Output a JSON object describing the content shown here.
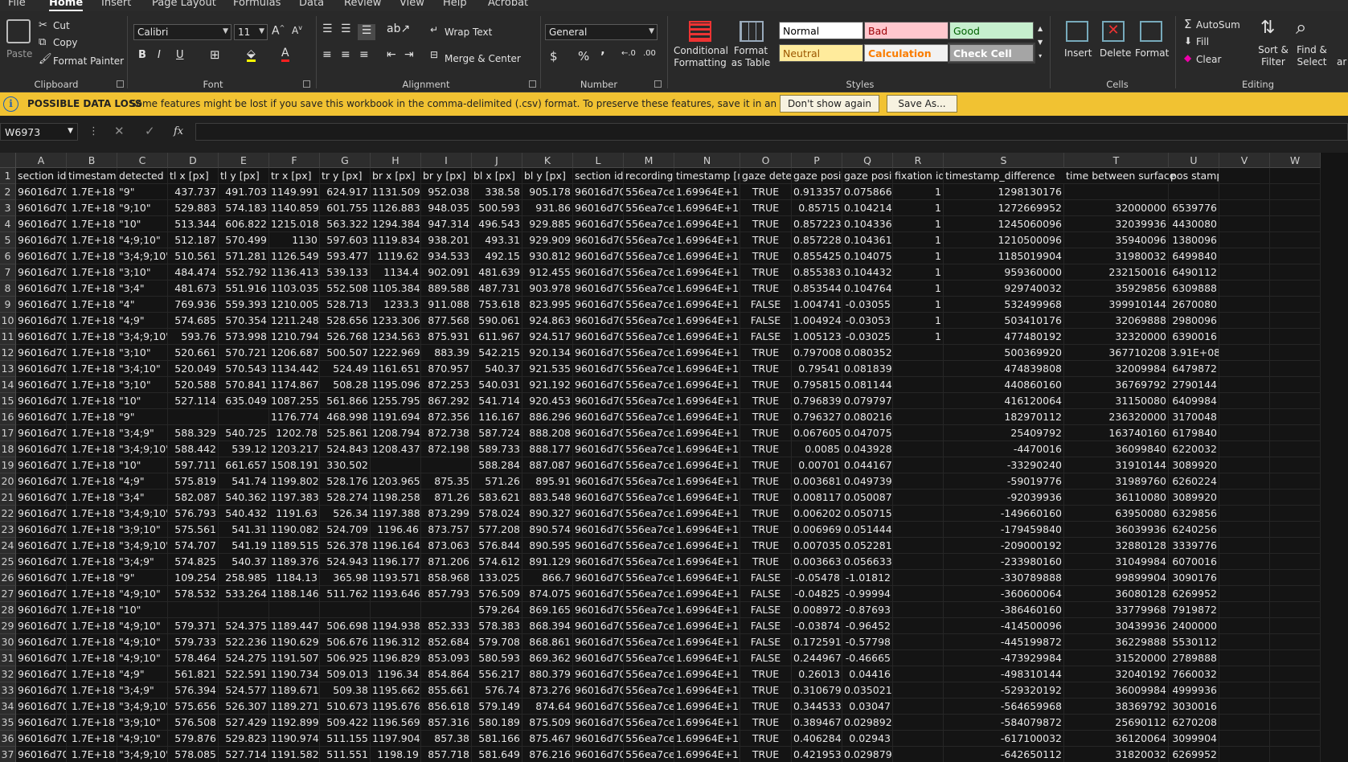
{
  "ribbon_tabs": [
    "File",
    "Home",
    "Insert",
    "Page Layout",
    "Formulas",
    "Data",
    "Review",
    "View",
    "Help",
    "Acrobat"
  ],
  "active_tab": "Home",
  "clipboard": {
    "paste": "Paste",
    "cut": "Cut",
    "copy": "Copy",
    "format_painter": "Format Painter",
    "group": "Clipboard"
  },
  "font": {
    "name": "Calibri",
    "size": "11",
    "bold": "B",
    "italic": "I",
    "underline": "U",
    "group": "Font"
  },
  "alignment": {
    "wrap_text": "Wrap Text",
    "merge_center": "Merge & Center",
    "group": "Alignment"
  },
  "number": {
    "format": "General",
    "currency": "$",
    "percent": "%",
    "comma": "’",
    "group": "Number"
  },
  "styles": {
    "conditional_formatting": "Conditional Formatting",
    "format_as_table": "Format as Table",
    "normal": "Normal",
    "bad": "Bad",
    "good": "Good",
    "neutral": "Neutral",
    "calculation": "Calculation",
    "check_cell": "Check Cell",
    "group": "Styles",
    "colors": {
      "normal_bg": "#ffffff",
      "bad_bg": "#ffc7ce",
      "bad_fg": "#9c0006",
      "good_bg": "#c6efce",
      "good_fg": "#006100",
      "neutral_bg": "#ffeb9c",
      "neutral_fg": "#9c5700",
      "calc_bg": "#f2f2f2",
      "calc_fg": "#fa7d00",
      "check_bg": "#a5a5a5"
    }
  },
  "cells_group": {
    "insert": "Insert",
    "delete": "Delete",
    "format": "Format",
    "group": "Cells"
  },
  "editing": {
    "autosum": "AutoSum",
    "fill": "Fill",
    "clear": "Clear",
    "sort_filter": "Sort & Filter",
    "find_select": "Find & Select",
    "group": "Editing",
    "extra": "ar"
  },
  "infobar": {
    "title": "POSSIBLE DATA LOSS",
    "message": "Some features might be lost if you save this workbook in the comma-delimited (.csv) format. To preserve these features, save it in an Excel file format.",
    "dont_show": "Don't show again",
    "save_as": "Save As..."
  },
  "namebox": "W6973",
  "fx_label": "fx",
  "columns": [
    "A",
    "B",
    "C",
    "D",
    "E",
    "F",
    "G",
    "H",
    "I",
    "J",
    "K",
    "L",
    "M",
    "N",
    "O",
    "P",
    "Q",
    "R",
    "S",
    "T",
    "U",
    "V",
    "W"
  ],
  "row1": [
    "section id",
    "timestamp",
    "detected m",
    "tl x [px]",
    "tl y [px]",
    "tr x [px]",
    "tr y [px]",
    "br x [px]",
    "br y [px]",
    "bl x [px]",
    "bl y [px]",
    "section id",
    "recording",
    "timestamp [ns]",
    "gaze dete",
    "gaze posit",
    "gaze posit",
    "fixation id",
    "timestamp_difference",
    "time between surface",
    "pos stamps",
    "",
    ""
  ],
  "rows": [
    [
      "96016d70-",
      "1.7E+18",
      "\"9\"",
      "437.737",
      "491.703",
      "1149.991",
      "624.917",
      "1131.509",
      "952.038",
      "338.58",
      "905.178",
      "96016d70-",
      "556ea7ce-",
      "1.69964E+18",
      "TRUE",
      "0.913357",
      "0.075866",
      "1",
      "1298130176",
      "",
      "",
      "",
      ""
    ],
    [
      "96016d70-",
      "1.7E+18",
      "\"9;10\"",
      "529.883",
      "574.183",
      "1140.859",
      "601.755",
      "1126.883",
      "948.035",
      "500.593",
      "931.86",
      "96016d70-",
      "556ea7ce-",
      "1.69964E+18",
      "TRUE",
      "0.85715",
      "0.104214",
      "1",
      "1272669952",
      "32000000",
      "6539776",
      "",
      ""
    ],
    [
      "96016d70-",
      "1.7E+18",
      "\"10\"",
      "513.344",
      "606.822",
      "1215.018",
      "563.322",
      "1294.384",
      "947.314",
      "496.543",
      "929.885",
      "96016d70-",
      "556ea7ce-",
      "1.69964E+18",
      "TRUE",
      "0.857223",
      "0.104336",
      "1",
      "1245060096",
      "32039936",
      "4430080",
      "",
      ""
    ],
    [
      "96016d70-",
      "1.7E+18",
      "\"4;9;10\"",
      "512.187",
      "570.499",
      "1130",
      "597.603",
      "1119.834",
      "938.201",
      "493.31",
      "929.909",
      "96016d70-",
      "556ea7ce-",
      "1.69964E+18",
      "TRUE",
      "0.857228",
      "0.104361",
      "1",
      "1210500096",
      "35940096",
      "1380096",
      "",
      ""
    ],
    [
      "96016d70-",
      "1.7E+18",
      "\"3;4;9;10\"",
      "510.561",
      "571.281",
      "1126.549",
      "593.477",
      "1119.62",
      "934.533",
      "492.15",
      "930.812",
      "96016d70-",
      "556ea7ce-",
      "1.69964E+18",
      "TRUE",
      "0.855425",
      "0.104075",
      "1",
      "1185019904",
      "31980032",
      "6499840",
      "",
      ""
    ],
    [
      "96016d70-",
      "1.7E+18",
      "\"3;10\"",
      "484.474",
      "552.792",
      "1136.413",
      "539.133",
      "1134.4",
      "902.091",
      "481.639",
      "912.455",
      "96016d70-",
      "556ea7ce-",
      "1.69964E+18",
      "TRUE",
      "0.855383",
      "0.104432",
      "1",
      "959360000",
      "232150016",
      "6490112",
      "",
      ""
    ],
    [
      "96016d70-",
      "1.7E+18",
      "\"3;4\"",
      "481.673",
      "551.916",
      "1103.035",
      "552.508",
      "1105.384",
      "889.588",
      "487.731",
      "903.978",
      "96016d70-",
      "556ea7ce-",
      "1.69964E+18",
      "TRUE",
      "0.853544",
      "0.104764",
      "1",
      "929740032",
      "35929856",
      "6309888",
      "",
      ""
    ],
    [
      "96016d70-",
      "1.7E+18",
      "\"4\"",
      "769.936",
      "559.393",
      "1210.005",
      "528.713",
      "1233.3",
      "911.088",
      "753.618",
      "823.995",
      "96016d70-",
      "556ea7ce-",
      "1.69964E+18",
      "FALSE",
      "1.004741",
      "-0.03055",
      "1",
      "532499968",
      "399910144",
      "2670080",
      "",
      ""
    ],
    [
      "96016d70-",
      "1.7E+18",
      "\"4;9\"",
      "574.685",
      "570.354",
      "1211.248",
      "528.656",
      "1233.306",
      "877.568",
      "590.061",
      "924.863",
      "96016d70-",
      "556ea7ce-",
      "1.69964E+18",
      "FALSE",
      "1.004924",
      "-0.03053",
      "1",
      "503410176",
      "32069888",
      "2980096",
      "",
      ""
    ],
    [
      "96016d70-",
      "1.7E+18",
      "\"3;4;9;10\"",
      "593.76",
      "573.998",
      "1210.794",
      "526.768",
      "1234.563",
      "875.931",
      "611.967",
      "924.517",
      "96016d70-",
      "556ea7ce-",
      "1.69964E+18",
      "FALSE",
      "1.005123",
      "-0.03025",
      "1",
      "477480192",
      "32320000",
      "6390016",
      "",
      ""
    ],
    [
      "96016d70-",
      "1.7E+18",
      "\"3;10\"",
      "520.661",
      "570.721",
      "1206.687",
      "500.507",
      "1222.969",
      "883.39",
      "542.215",
      "920.134",
      "96016d70-",
      "556ea7ce-",
      "1.69964E+18",
      "TRUE",
      "0.797008",
      "0.080352",
      "",
      "500369920",
      "367710208",
      "3.91E+08",
      "",
      ""
    ],
    [
      "96016d70-",
      "1.7E+18",
      "\"3;4;10\"",
      "520.049",
      "570.543",
      "1134.442",
      "524.49",
      "1161.651",
      "870.957",
      "540.37",
      "921.535",
      "96016d70-",
      "556ea7ce-",
      "1.69964E+18",
      "TRUE",
      "0.79541",
      "0.081839",
      "",
      "474839808",
      "32009984",
      "6479872",
      "",
      ""
    ],
    [
      "96016d70-",
      "1.7E+18",
      "\"3;10\"",
      "520.588",
      "570.841",
      "1174.867",
      "508.28",
      "1195.096",
      "872.253",
      "540.031",
      "921.192",
      "96016d70-",
      "556ea7ce-",
      "1.69964E+18",
      "TRUE",
      "0.795815",
      "0.081144",
      "",
      "440860160",
      "36769792",
      "2790144",
      "",
      ""
    ],
    [
      "96016d70-",
      "1.7E+18",
      "\"10\"",
      "527.114",
      "635.049",
      "1087.255",
      "561.866",
      "1255.795",
      "867.292",
      "541.714",
      "920.453",
      "96016d70-",
      "556ea7ce-",
      "1.69964E+18",
      "TRUE",
      "0.796839",
      "0.079797",
      "",
      "416120064",
      "31150080",
      "6409984",
      "",
      ""
    ],
    [
      "96016d70-",
      "1.7E+18",
      "\"9\"",
      "",
      "",
      "1176.774",
      "468.998",
      "1191.694",
      "872.356",
      "116.167",
      "886.296",
      "96016d70-",
      "556ea7ce-",
      "1.69964E+18",
      "TRUE",
      "0.796327",
      "0.080216",
      "",
      "182970112",
      "236320000",
      "3170048",
      "",
      ""
    ],
    [
      "96016d70-",
      "1.7E+18",
      "\"3;4;9\"",
      "588.329",
      "540.725",
      "1202.78",
      "525.861",
      "1208.794",
      "872.738",
      "587.724",
      "888.208",
      "96016d70-",
      "556ea7ce-",
      "1.69964E+18",
      "TRUE",
      "0.067605",
      "0.047075",
      "",
      "25409792",
      "163740160",
      "6179840",
      "",
      ""
    ],
    [
      "96016d70-",
      "1.7E+18",
      "\"3;4;9;10\"",
      "588.442",
      "539.12",
      "1203.217",
      "524.843",
      "1208.437",
      "872.198",
      "589.733",
      "888.177",
      "96016d70-",
      "556ea7ce-",
      "1.69964E+18",
      "TRUE",
      "0.0085",
      "0.043928",
      "",
      "-4470016",
      "36099840",
      "6220032",
      "",
      ""
    ],
    [
      "96016d70-",
      "1.7E+18",
      "\"10\"",
      "597.711",
      "661.657",
      "1508.191",
      "330.502",
      "",
      "",
      "588.284",
      "887.087",
      "96016d70-",
      "556ea7ce-",
      "1.69964E+18",
      "TRUE",
      "0.00701",
      "0.044167",
      "",
      "-33290240",
      "31910144",
      "3089920",
      "",
      ""
    ],
    [
      "96016d70-",
      "1.7E+18",
      "\"4;9\"",
      "575.819",
      "541.74",
      "1199.802",
      "528.176",
      "1203.965",
      "875.35",
      "571.26",
      "895.91",
      "96016d70-",
      "556ea7ce-",
      "1.69964E+18",
      "TRUE",
      "0.003681",
      "0.049739",
      "",
      "-59019776",
      "31989760",
      "6260224",
      "",
      ""
    ],
    [
      "96016d70-",
      "1.7E+18",
      "\"3;4\"",
      "582.087",
      "540.362",
      "1197.383",
      "528.274",
      "1198.258",
      "871.26",
      "583.621",
      "883.548",
      "96016d70-",
      "556ea7ce-",
      "1.69964E+18",
      "TRUE",
      "0.008117",
      "0.050087",
      "",
      "-92039936",
      "36110080",
      "3089920",
      "",
      ""
    ],
    [
      "96016d70-",
      "1.7E+18",
      "\"3;4;9;10\"",
      "576.793",
      "540.432",
      "1191.63",
      "526.34",
      "1197.388",
      "873.299",
      "578.024",
      "890.327",
      "96016d70-",
      "556ea7ce-",
      "1.69964E+18",
      "TRUE",
      "0.006202",
      "0.050715",
      "",
      "-149660160",
      "63950080",
      "6329856",
      "",
      ""
    ],
    [
      "96016d70-",
      "1.7E+18",
      "\"3;9;10\"",
      "575.561",
      "541.31",
      "1190.082",
      "524.709",
      "1196.46",
      "873.757",
      "577.208",
      "890.574",
      "96016d70-",
      "556ea7ce-",
      "1.69964E+18",
      "TRUE",
      "0.006969",
      "0.051444",
      "",
      "-179459840",
      "36039936",
      "6240256",
      "",
      ""
    ],
    [
      "96016d70-",
      "1.7E+18",
      "\"3;4;9;10\"",
      "574.707",
      "541.19",
      "1189.515",
      "526.378",
      "1196.164",
      "873.063",
      "576.844",
      "890.595",
      "96016d70-",
      "556ea7ce-",
      "1.69964E+18",
      "TRUE",
      "0.007035",
      "0.052281",
      "",
      "-209000192",
      "32880128",
      "3339776",
      "",
      ""
    ],
    [
      "96016d70-",
      "1.7E+18",
      "\"3;4;9\"",
      "574.825",
      "540.37",
      "1189.376",
      "524.943",
      "1196.177",
      "871.206",
      "574.612",
      "891.129",
      "96016d70-",
      "556ea7ce-",
      "1.69964E+18",
      "TRUE",
      "0.003663",
      "0.056633",
      "",
      "-233980160",
      "31049984",
      "6070016",
      "",
      ""
    ],
    [
      "96016d70-",
      "1.7E+18",
      "\"9\"",
      "109.254",
      "258.985",
      "1184.13",
      "365.98",
      "1193.571",
      "858.968",
      "133.025",
      "866.7",
      "96016d70-",
      "556ea7ce-",
      "1.69964E+18",
      "FALSE",
      "-0.05478",
      "-1.01812",
      "",
      "-330789888",
      "99899904",
      "3090176",
      "",
      ""
    ],
    [
      "96016d70-",
      "1.7E+18",
      "\"4;9;10\"",
      "578.532",
      "533.264",
      "1188.146",
      "511.762",
      "1193.646",
      "857.793",
      "576.509",
      "874.075",
      "96016d70-",
      "556ea7ce-",
      "1.69964E+18",
      "FALSE",
      "-0.04825",
      "-0.99994",
      "",
      "-360600064",
      "36080128",
      "6269952",
      "",
      ""
    ],
    [
      "96016d70-",
      "1.7E+18",
      "\"10\"",
      "",
      "",
      "",
      "",
      "",
      "",
      "579.264",
      "869.165",
      "96016d70-",
      "556ea7ce-",
      "1.69964E+18",
      "FALSE",
      "0.008972",
      "-0.87693",
      "",
      "-386460160",
      "33779968",
      "7919872",
      "",
      ""
    ],
    [
      "96016d70-",
      "1.7E+18",
      "\"4;9;10\"",
      "579.371",
      "524.375",
      "1189.447",
      "506.698",
      "1194.938",
      "852.333",
      "578.383",
      "868.394",
      "96016d70-",
      "556ea7ce-",
      "1.69964E+18",
      "FALSE",
      "-0.03874",
      "-0.96452",
      "",
      "-414500096",
      "30439936",
      "2400000",
      "",
      ""
    ],
    [
      "96016d70-",
      "1.7E+18",
      "\"4;9;10\"",
      "579.733",
      "522.236",
      "1190.629",
      "506.676",
      "1196.312",
      "852.684",
      "579.708",
      "868.861",
      "96016d70-",
      "556ea7ce-",
      "1.69964E+18",
      "FALSE",
      "0.172591",
      "-0.57798",
      "",
      "-445199872",
      "36229888",
      "5530112",
      "",
      ""
    ],
    [
      "96016d70-",
      "1.7E+18",
      "\"4;9;10\"",
      "578.464",
      "524.275",
      "1191.507",
      "506.925",
      "1196.829",
      "853.093",
      "580.593",
      "869.362",
      "96016d70-",
      "556ea7ce-",
      "1.69964E+18",
      "FALSE",
      "0.244967",
      "-0.46665",
      "",
      "-473929984",
      "31520000",
      "2789888",
      "",
      ""
    ],
    [
      "96016d70-",
      "1.7E+18",
      "\"4;9\"",
      "561.821",
      "522.591",
      "1190.734",
      "509.013",
      "1196.34",
      "854.864",
      "556.217",
      "880.379",
      "96016d70-",
      "556ea7ce-",
      "1.69964E+18",
      "TRUE",
      "0.26013",
      "0.04416",
      "",
      "-498310144",
      "32040192",
      "7660032",
      "",
      ""
    ],
    [
      "96016d70-",
      "1.7E+18",
      "\"3;4;9\"",
      "576.394",
      "524.577",
      "1189.671",
      "509.38",
      "1195.662",
      "855.661",
      "576.74",
      "873.276",
      "96016d70-",
      "556ea7ce-",
      "1.69964E+18",
      "TRUE",
      "0.310679",
      "0.035021",
      "",
      "-529320192",
      "36009984",
      "4999936",
      "",
      ""
    ],
    [
      "96016d70-",
      "1.7E+18",
      "\"3;4;9;10\"",
      "575.656",
      "526.307",
      "1189.271",
      "510.673",
      "1195.676",
      "856.618",
      "579.149",
      "874.64",
      "96016d70-",
      "556ea7ce-",
      "1.69964E+18",
      "TRUE",
      "0.344533",
      "0.03047",
      "",
      "-564659968",
      "38369792",
      "3030016",
      "",
      ""
    ],
    [
      "96016d70-",
      "1.7E+18",
      "\"3;9;10\"",
      "576.508",
      "527.429",
      "1192.899",
      "509.422",
      "1196.569",
      "857.316",
      "580.189",
      "875.509",
      "96016d70-",
      "556ea7ce-",
      "1.69964E+18",
      "TRUE",
      "0.389467",
      "0.029892",
      "",
      "-584079872",
      "25690112",
      "6270208",
      "",
      ""
    ],
    [
      "96016d70-",
      "1.7E+18",
      "\"4;9;10\"",
      "579.876",
      "529.823",
      "1190.974",
      "511.155",
      "1197.904",
      "857.38",
      "581.166",
      "875.467",
      "96016d70-",
      "556ea7ce-",
      "1.69964E+18",
      "TRUE",
      "0.406284",
      "0.02943",
      "",
      "-617100032",
      "36120064",
      "3099904",
      "",
      ""
    ],
    [
      "96016d70-",
      "1.7E+18",
      "\"3;4;9;10\"",
      "578.085",
      "527.714",
      "1191.582",
      "511.551",
      "1198.19",
      "857.718",
      "581.649",
      "876.216",
      "96016d70-",
      "556ea7ce-",
      "1.69964E+18",
      "TRUE",
      "0.421953",
      "0.029879",
      "",
      "-642650112",
      "31820032",
      "6269952",
      "",
      ""
    ]
  ]
}
